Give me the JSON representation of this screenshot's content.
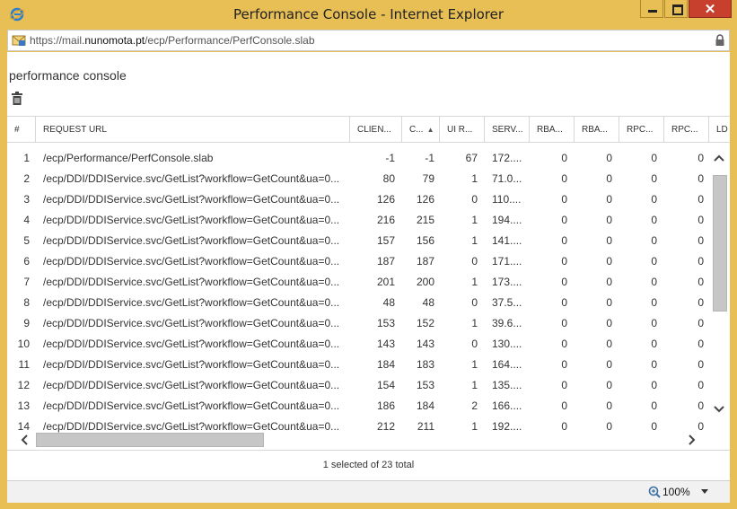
{
  "window": {
    "title": "Performance Console - Internet Explorer",
    "close_label": "✕"
  },
  "address": {
    "prefix": "https://mail.",
    "host": "nunomota.pt",
    "path": "/ecp/Performance/PerfConsole.slab"
  },
  "page": {
    "title": "performance console"
  },
  "table": {
    "columns": [
      "#",
      "REQUEST URL",
      "CLIEN...",
      "C...",
      "UI R...",
      "SERV...",
      "RBA...",
      "RBA...",
      "RPC...",
      "RPC...",
      "LD"
    ],
    "sorted_column": "C...",
    "rows": [
      [
        "1",
        "/ecp/Performance/PerfConsole.slab",
        "-1",
        "-1",
        "67",
        "172....",
        "0",
        "0",
        "0",
        "0"
      ],
      [
        "2",
        "/ecp/DDI/DDIService.svc/GetList?workflow=GetCount&ua=0...",
        "80",
        "79",
        "1",
        "71.0...",
        "0",
        "0",
        "0",
        "0"
      ],
      [
        "3",
        "/ecp/DDI/DDIService.svc/GetList?workflow=GetCount&ua=0...",
        "126",
        "126",
        "0",
        "110....",
        "0",
        "0",
        "0",
        "0"
      ],
      [
        "4",
        "/ecp/DDI/DDIService.svc/GetList?workflow=GetCount&ua=0...",
        "216",
        "215",
        "1",
        "194....",
        "0",
        "0",
        "0",
        "0"
      ],
      [
        "5",
        "/ecp/DDI/DDIService.svc/GetList?workflow=GetCount&ua=0...",
        "157",
        "156",
        "1",
        "141....",
        "0",
        "0",
        "0",
        "0"
      ],
      [
        "6",
        "/ecp/DDI/DDIService.svc/GetList?workflow=GetCount&ua=0...",
        "187",
        "187",
        "0",
        "171....",
        "0",
        "0",
        "0",
        "0"
      ],
      [
        "7",
        "/ecp/DDI/DDIService.svc/GetList?workflow=GetCount&ua=0...",
        "201",
        "200",
        "1",
        "173....",
        "0",
        "0",
        "0",
        "0"
      ],
      [
        "8",
        "/ecp/DDI/DDIService.svc/GetList?workflow=GetCount&ua=0...",
        "48",
        "48",
        "0",
        "37.5...",
        "0",
        "0",
        "0",
        "0"
      ],
      [
        "9",
        "/ecp/DDI/DDIService.svc/GetList?workflow=GetCount&ua=0...",
        "153",
        "152",
        "1",
        "39.6...",
        "0",
        "0",
        "0",
        "0"
      ],
      [
        "10",
        "/ecp/DDI/DDIService.svc/GetList?workflow=GetCount&ua=0...",
        "143",
        "143",
        "0",
        "130....",
        "0",
        "0",
        "0",
        "0"
      ],
      [
        "11",
        "/ecp/DDI/DDIService.svc/GetList?workflow=GetCount&ua=0...",
        "184",
        "183",
        "1",
        "164....",
        "0",
        "0",
        "0",
        "0"
      ],
      [
        "12",
        "/ecp/DDI/DDIService.svc/GetList?workflow=GetCount&ua=0...",
        "154",
        "153",
        "1",
        "135....",
        "0",
        "0",
        "0",
        "0"
      ],
      [
        "13",
        "/ecp/DDI/DDIService.svc/GetList?workflow=GetCount&ua=0...",
        "186",
        "184",
        "2",
        "166....",
        "0",
        "0",
        "0",
        "0"
      ],
      [
        "14",
        "/ecp/DDI/DDIService.svc/GetList?workflow=GetCount&ua=0...",
        "212",
        "211",
        "1",
        "192....",
        "0",
        "0",
        "0",
        "0"
      ]
    ]
  },
  "footer": {
    "status": "1 selected of 23 total"
  },
  "statusbar": {
    "zoom": "100%"
  },
  "colors": {
    "frame": "#e7bf55",
    "close": "#c7402d"
  }
}
